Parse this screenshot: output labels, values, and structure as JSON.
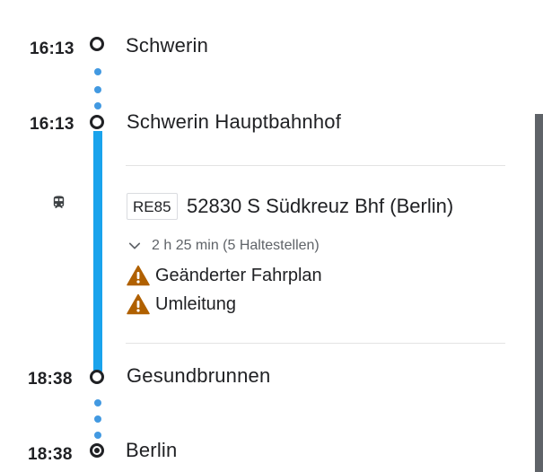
{
  "stops": [
    {
      "time": "16:13",
      "name": "Schwerin"
    },
    {
      "time": "16:13",
      "name": "Schwerin Hauptbahnhof"
    },
    {
      "time": "18:38",
      "name": "Gesundbrunnen"
    },
    {
      "time": "18:38",
      "name": "Berlin"
    }
  ],
  "transit": {
    "mode_icon": "train-icon",
    "route": "RE85",
    "headsign": "52830 S Südkreuz Bhf (Berlin)",
    "duration": "2 h 25 min (5 Haltestellen)",
    "line_color": "#1aa3ec",
    "alerts": [
      {
        "icon": "warning-icon",
        "text": "Geänderter Fahrplan"
      },
      {
        "icon": "warning-icon",
        "text": "Umleitung"
      }
    ]
  },
  "colors": {
    "walk_dots": "#4299e1",
    "alert": "#b06000",
    "text": "#202124",
    "muted": "#5f6368"
  }
}
